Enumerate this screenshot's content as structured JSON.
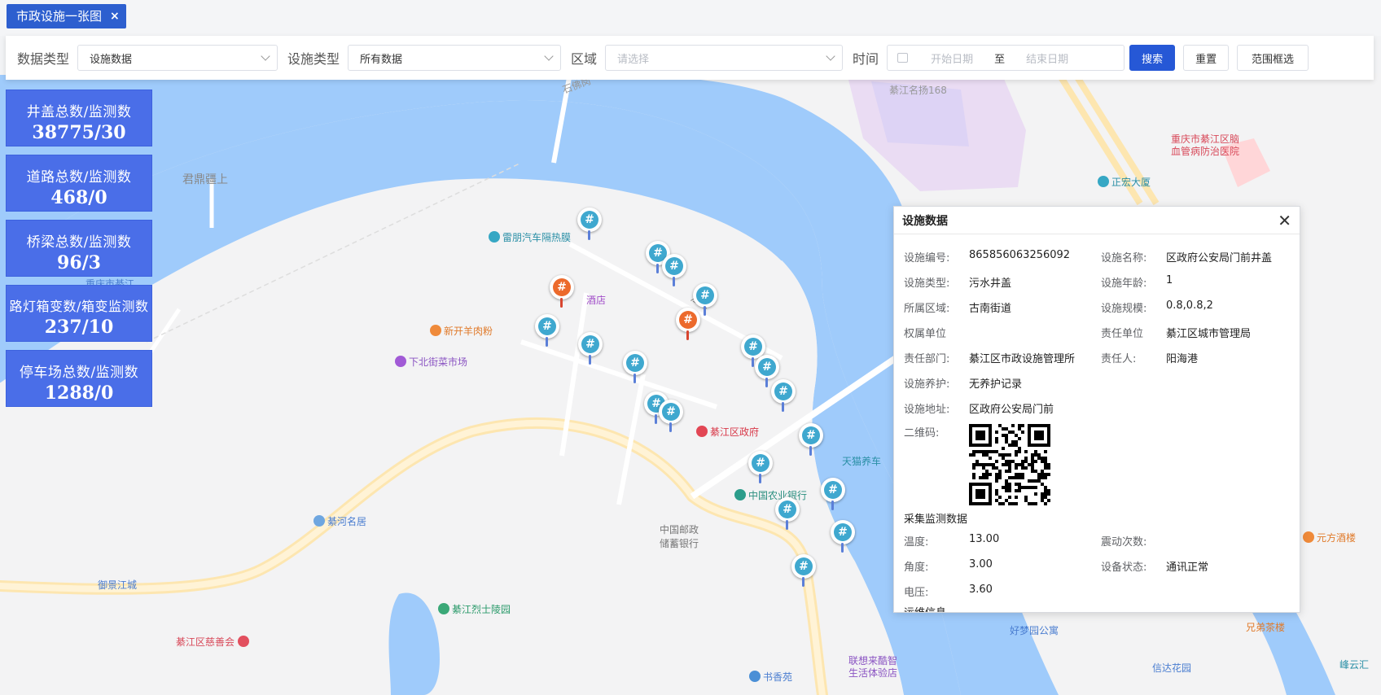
{
  "tab": {
    "label": "市政设施一张图",
    "close": "×"
  },
  "filter": {
    "data_type_label": "数据类型",
    "data_type_value": "设施数据",
    "facility_type_label": "设施类型",
    "facility_type_value": "所有数据",
    "area_label": "区域",
    "area_placeholder": "请选择",
    "time_label": "时间",
    "start_placeholder": "开始日期",
    "to": "至",
    "end_placeholder": "结束日期",
    "search": "搜索",
    "reset": "重置",
    "range_select": "范围框选"
  },
  "stats": [
    {
      "title": "井盖总数/监测数",
      "value": "38775/30"
    },
    {
      "title": "道路总数/监测数",
      "value": "468/0"
    },
    {
      "title": "桥梁总数/监测数",
      "value": "96/3"
    },
    {
      "title": "路灯箱变数/箱变监测数",
      "value": "237/10"
    },
    {
      "title": "停车场总数/监测数",
      "value": "1288/0"
    }
  ],
  "popup": {
    "title": "设施数据",
    "fields": [
      [
        "设施编号:",
        "865856063256092",
        "设施名称:",
        "区政府公安局门前井盖"
      ],
      [
        "设施类型:",
        "污水井盖",
        "设施年龄:",
        "1"
      ],
      [
        "所属区域:",
        "古南街道",
        "设施规模:",
        "0.8,0.8,2"
      ],
      [
        "权属单位",
        "",
        "责任单位",
        "綦江区城市管理局"
      ],
      [
        "责任部门:",
        "綦江区市政设施管理所",
        "责任人:",
        "阳海港"
      ],
      [
        "设施养护:",
        "无养护记录",
        "",
        ""
      ],
      [
        "设施地址:",
        "区政府公安局门前",
        "",
        ""
      ]
    ],
    "qr_label": "二维码:",
    "monitor_title": "采集监测数据",
    "monitor": [
      [
        "温度:",
        "13.00",
        "震动次数:",
        ""
      ],
      [
        "角度:",
        "3.00",
        "设备状态:",
        "通讯正常"
      ],
      [
        "电压:",
        "3.60",
        "",
        ""
      ]
    ],
    "maintenance_title": "运维信息"
  },
  "map_labels": {
    "l1": "君鼎疆上",
    "l2": "重庆市綦江",
    "l3": "雷朋汽车隔热膜",
    "l4": "酒店",
    "l5": "新开羊肉粉",
    "l6": "下北街菜市场",
    "l7": "綦江区政府",
    "l8": "中国农业银行",
    "l9": "中国邮政",
    "l10": "储蓄银行",
    "l11": "綦河名居",
    "l12": "御景江城",
    "l13": "綦江烈士陵园",
    "l14": "綦江区慈善会",
    "l15": "天猫养车",
    "l16": "书香苑",
    "l17": "联想来酷智",
    "l18": "生活体验店",
    "l19": "好梦园公寓",
    "l20": "信达花园",
    "l21": "兄弟茶楼",
    "l22": "峰云汇",
    "l23": "元方酒楼",
    "l24": "重庆市綦江区脑",
    "l25": "血管病防治医院",
    "l26": "正宏大厦",
    "l27": "綦江名扬168",
    "l28": "石佛岗",
    "l29": "江路"
  },
  "colors": {
    "primary": "#2658d6",
    "card": "#4a6ee8",
    "river": "#9fcbfb",
    "road": "#fde6b0"
  },
  "icons": {
    "marker": "manhole-marker-icon",
    "alert_marker": "manhole-alert-marker-icon"
  }
}
